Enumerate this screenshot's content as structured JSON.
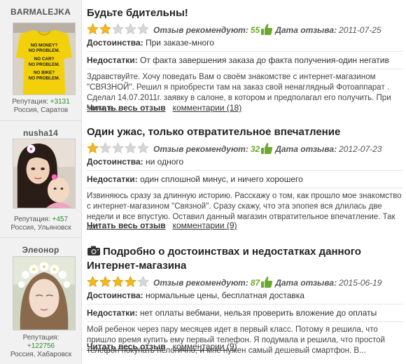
{
  "ui": {
    "recommend_label": "Отзыв рекомендуют:",
    "date_label": "Дата отзыва:",
    "pros_label": "Достоинства:",
    "cons_label": "Недостатки:",
    "read_more": "Читать весь отзыв",
    "reputation_label": "Репутация:",
    "star_color": "#f5b71e",
    "star_empty_color": "#d6d6d6",
    "accent_green": "#6aa82e"
  },
  "reviews": [
    {
      "user": "BARMALEJKA",
      "reputation": "+3131",
      "location": "Россия, Саратов",
      "title": "Будьте бдительны!",
      "rating": 2,
      "rating_max": 5,
      "recommend": "55",
      "date": "2011-07-25",
      "pros": "При заказе-много",
      "cons": "От факта завершения заказа до факта получения-один негатив",
      "excerpt": "Здравствуйте. Хочу поведать Вам о своём знакомстве с интернет-магазином \"СВЯЗНОЙ\". Решил я приобрести там на заказ свой ненаглядный Фотоаппарат . Сделал 14.07.2011г. заявку в салоне, в котором и предполагал его получить. При этом, в...",
      "comments": "комментарии (18)",
      "avatar_shirt_text": [
        "NO MONEY?",
        "NO PROBLEM.",
        "NO CAR?",
        "NO PROBLEM.",
        "NO BIKE?",
        "NO PROBLEM."
      ]
    },
    {
      "user": "nusha14",
      "reputation": "+457",
      "location": "Россия, Ульяновск",
      "title": "Один ужас, только отвратительное впечатление",
      "rating": 1,
      "rating_max": 5,
      "recommend": "32",
      "date": "2012-07-23",
      "pros": "ни одного",
      "cons": "один сплошной минус, и ничего хорошего",
      "excerpt": "Извиняюсь сразу за длинную историю. Расскажу о том, как прошло мое знакомство с интернет-магазином \"Связной\". Сразу скажу, что эта эпопея вся длилась две недели и все впустую. Оставил данный магазин отвратительное впечатление. Так вот...",
      "comments": "комментарии (9)"
    },
    {
      "user": "Элеонор",
      "reputation": "+122756",
      "location": "Россия, Хабаровск",
      "title": "Подробно о достоинствах и недостатках данного Интернет-магазина",
      "rating": 4,
      "rating_max": 5,
      "recommend": "87",
      "date": "2015-06-19",
      "pros": "нормальные цены, бесплатная доставка",
      "cons": "нет оплаты вебмани, нельзя проверить вложение до оплаты",
      "excerpt": "Мой ребенок через пару месяцев идет в первый класс. Потому я решила, что пришло время купить ему первый телефон. Я подумала и решила, что простой телефон покупать нелогично, и мне нужен самый дешевый смартфон. В...",
      "comments": "комментарии (9)"
    }
  ]
}
